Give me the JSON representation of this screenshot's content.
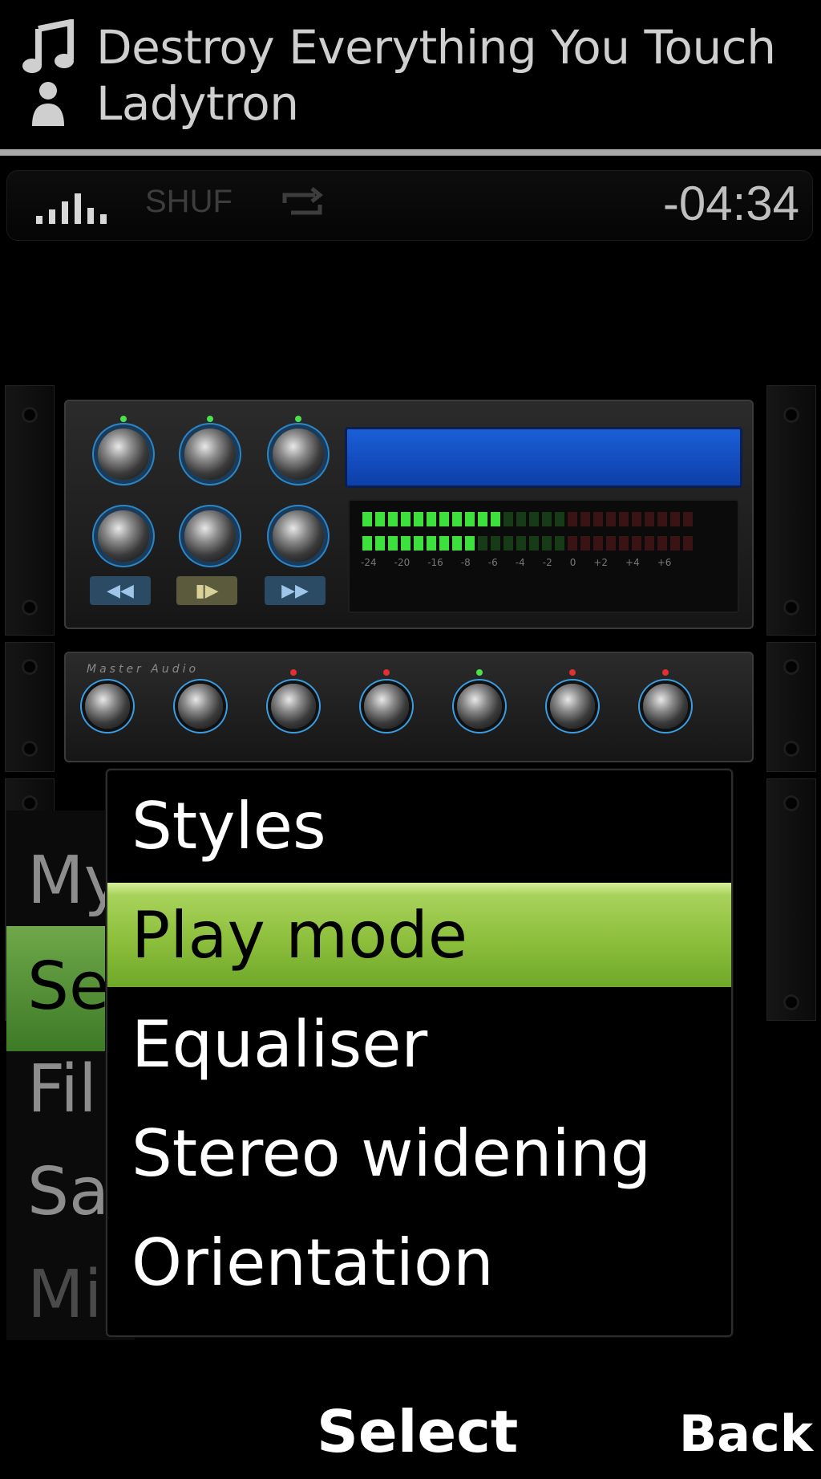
{
  "now_playing": {
    "track_title": "Destroy Everything You Touch",
    "artist": "Ladytron",
    "music_icon": "music-note-icon",
    "artist_icon": "person-icon"
  },
  "status_bar": {
    "signal_icon": "signal-bars-icon",
    "shuffle_label": "SHUF",
    "repeat_icon": "repeat-icon",
    "time_remaining": "-04:34"
  },
  "rack": {
    "master_audio_label": "Master Audio",
    "transport": {
      "rewind_icon": "rewind-icon",
      "play_pause_icon": "play-pause-icon",
      "fast_forward_icon": "fast-forward-icon"
    }
  },
  "background_menu": {
    "items": [
      "My",
      "Se",
      "Fil",
      "Sa",
      "Mi"
    ],
    "selected_index": 1
  },
  "popup_menu": {
    "items": [
      "Styles",
      "Play mode",
      "Equaliser",
      "Stereo widening",
      "Orientation"
    ],
    "selected_index": 1
  },
  "softkeys": {
    "left": "",
    "center": "Select",
    "right": "Back"
  },
  "colors": {
    "highlight": "#8dbf3c",
    "lcd_blue": "#1a5fd8",
    "knob_ring": "#2b86c9"
  }
}
